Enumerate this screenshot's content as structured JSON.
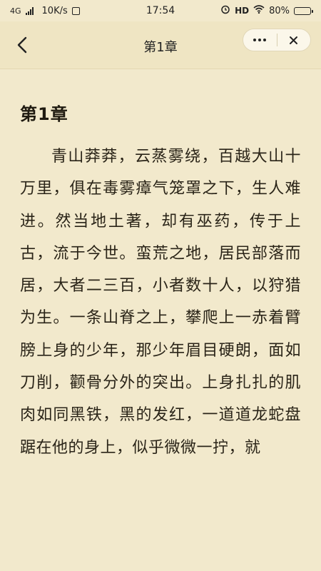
{
  "status_bar": {
    "network": "4G",
    "speed": "10K/s",
    "extra_icon": "sim-icon",
    "time": "17:54",
    "alarm_icon": "alarm-icon",
    "hd": "HD",
    "wifi_icon": "wifi-icon",
    "battery_percent": "80%",
    "battery_level": 0.8
  },
  "nav": {
    "back_icon": "back-arrow-icon",
    "title": "第1章",
    "more_icon": "more-dots-icon",
    "close_icon": "close-icon"
  },
  "content": {
    "chapter_title": "第1章",
    "paragraph": "青山莽莽，云蒸雾绕，百越大山十万里，俱在毒雾瘴气笼罩之下，生人难进。然当地土著，却有巫药，传于上古，流于今世。蛮荒之地，居民部落而居，大者二三百，小者数十人，以狩猎为生。一条山脊之上，攀爬上一赤着臂膀上身的少年，那少年眉目硬朗，面如刀削，颧骨分外的突出。上身扎扎的肌肉如同黑铁，黑的发红，一道道龙蛇盘踞在他的身上，似乎微微一拧，就"
  },
  "colors": {
    "background": "#f2e9cc",
    "navbar": "#efe5c3",
    "text": "#2a2418"
  }
}
